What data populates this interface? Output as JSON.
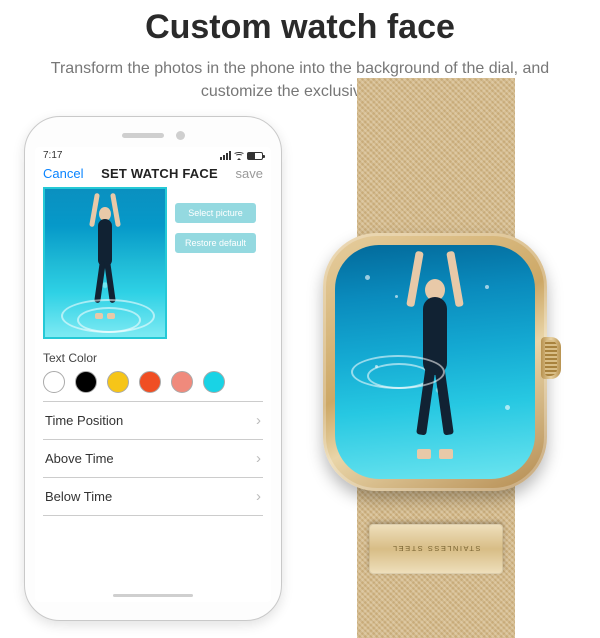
{
  "heading": "Custom watch face",
  "subtext": "Transform the photos in the phone into the background of the dial, and customize the exclusive dial",
  "phone": {
    "status_time": "7:17",
    "nav": {
      "cancel": "Cancel",
      "title": "SET WATCH FACE",
      "save": "save"
    },
    "buttons": {
      "select": "Select picture",
      "restore": "Restore default"
    },
    "text_color_label": "Text Color",
    "swatch_colors": [
      "#ffffff",
      "#000000",
      "#f6c518",
      "#f04e23",
      "#f08a7c",
      "#19d3e5"
    ],
    "rows": {
      "time_position": "Time Position",
      "above_time": "Above Time",
      "below_time": "Below Time"
    }
  },
  "watch": {
    "clasp_text": "STAINLESS STEEL"
  }
}
